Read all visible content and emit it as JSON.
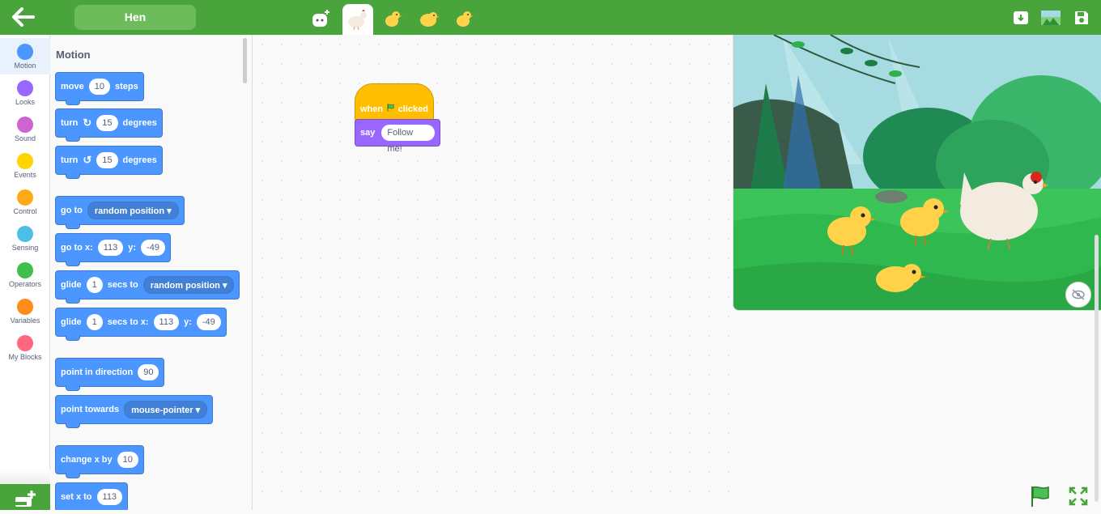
{
  "header": {
    "sprite_name": "Hen",
    "sprite_tabs": [
      "add-sprite",
      "hen",
      "chick-1",
      "chick-2",
      "chick-3"
    ],
    "active_tab": "hen"
  },
  "categories": [
    {
      "label": "Motion",
      "color": "#4c97ff"
    },
    {
      "label": "Looks",
      "color": "#9966ff"
    },
    {
      "label": "Sound",
      "color": "#cf63cf"
    },
    {
      "label": "Events",
      "color": "#ffd500"
    },
    {
      "label": "Control",
      "color": "#ffab19"
    },
    {
      "label": "Sensing",
      "color": "#4cbfe6"
    },
    {
      "label": "Operators",
      "color": "#40bf4a"
    },
    {
      "label": "Variables",
      "color": "#ff8c1a"
    },
    {
      "label": "My Blocks",
      "color": "#ff6680"
    }
  ],
  "palette": {
    "title": "Motion",
    "blocks": [
      {
        "parts": [
          "move",
          "10",
          "steps"
        ]
      },
      {
        "parts": [
          "turn",
          "15",
          "degrees"
        ]
      },
      {
        "parts": [
          "turn",
          "15",
          "degrees"
        ]
      },
      {
        "parts": [
          "go to",
          "random position"
        ]
      },
      {
        "parts": [
          "go to x:",
          "113",
          "y:",
          "-49"
        ]
      },
      {
        "parts": [
          "glide",
          "1",
          "secs to",
          "random position"
        ]
      },
      {
        "parts": [
          "glide",
          "1",
          "secs to x:",
          "113",
          "y:",
          "-49"
        ]
      },
      {
        "parts": [
          "point in direction",
          "90"
        ]
      },
      {
        "parts": [
          "point towards",
          "mouse-pointer"
        ]
      },
      {
        "parts": [
          "change x by",
          "10"
        ]
      },
      {
        "parts": [
          "set x to",
          "113"
        ]
      }
    ]
  },
  "script": {
    "hat": {
      "when": "when",
      "clicked": "clicked"
    },
    "say": {
      "label": "say",
      "message": "Follow me!"
    }
  },
  "colors": {
    "topbar": "#4aa43c",
    "motion": "#4c97ff",
    "events": "#ffbf00",
    "looks": "#9966ff"
  }
}
